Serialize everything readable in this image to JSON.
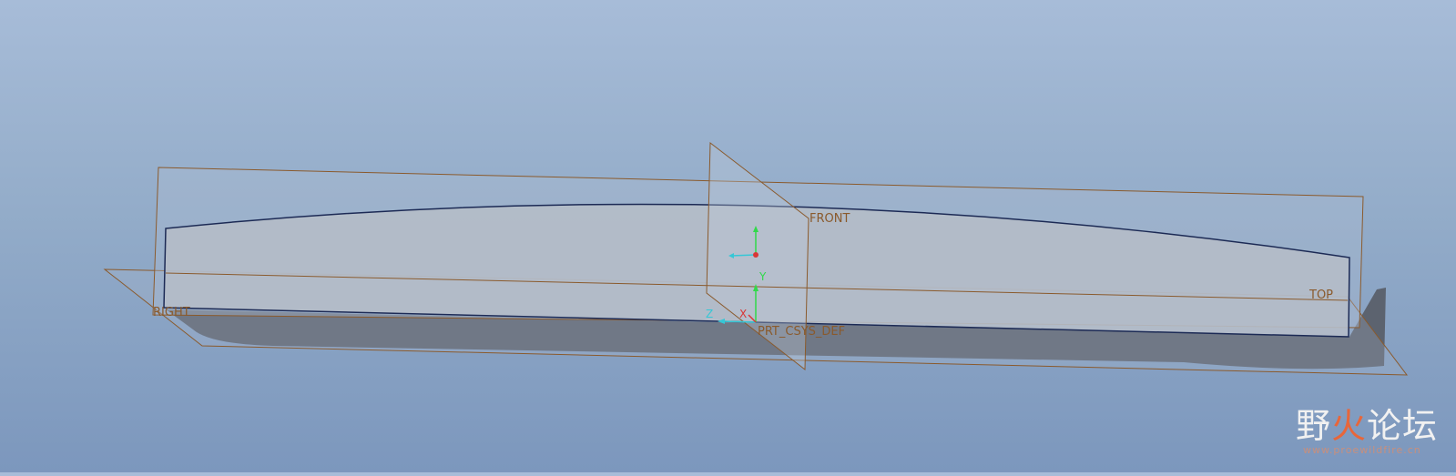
{
  "viewport": {
    "background_top": "#a7bcd8",
    "background_bottom": "#7c97bd"
  },
  "datum_planes": {
    "front_label": "FRONT",
    "top_label": "TOP",
    "right_label": "RIGHT",
    "plane_color": "#8a5a2c"
  },
  "coordinate_system": {
    "name_label": "PRT_CSYS_DEF",
    "axis_x": "X",
    "axis_y": "Y",
    "axis_z": "Z"
  },
  "model": {
    "face_color": "#b8c0cc",
    "side_color": "#5c636f",
    "edge_color": "#1c2a55"
  },
  "watermark": {
    "logo_part1": "野",
    "logo_part2": "火",
    "logo_part3": "论坛",
    "url": "www.proewildfire.cn"
  }
}
